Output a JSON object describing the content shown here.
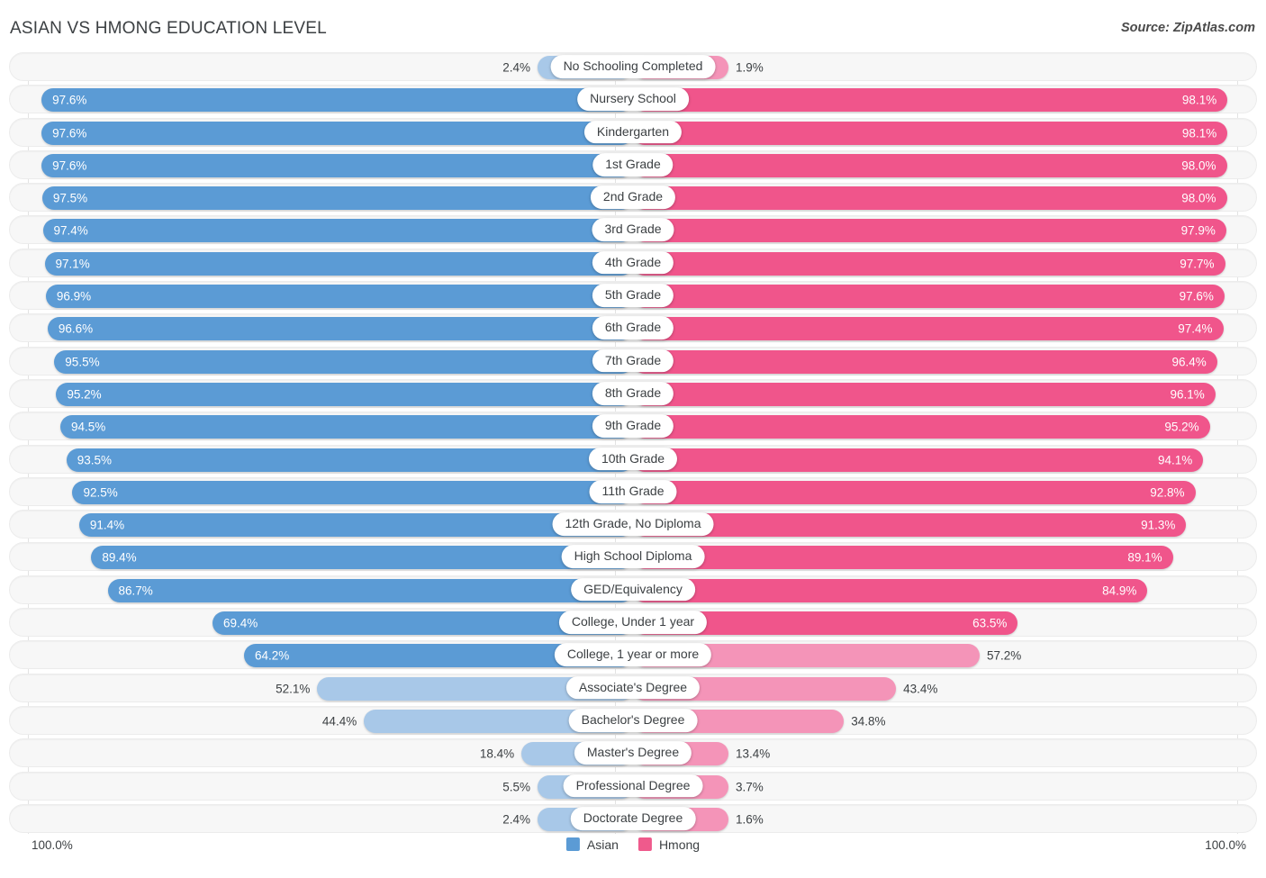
{
  "header": {
    "title": "ASIAN VS HMONG EDUCATION LEVEL",
    "source": "Source: ZipAtlas.com"
  },
  "axis": {
    "min_label": "100.0%",
    "max_label": "100.0%"
  },
  "legend": {
    "items": [
      {
        "label": "Asian",
        "color": "#5b9bd5"
      },
      {
        "label": "Hmong",
        "color": "#ef5a8c"
      }
    ]
  },
  "colors": {
    "asian_strong": "#5b9bd5",
    "asian_light": "#a8c8e8",
    "hmong_strong": "#f0558b",
    "hmong_light": "#f494b8",
    "track": "#f7f7f7",
    "gridline": "#e3e3e3"
  },
  "chart_data": {
    "type": "bar",
    "orientation": "horizontal-diverging",
    "title": "ASIAN VS HMONG EDUCATION LEVEL",
    "xlabel": "",
    "ylabel": "",
    "xlim": [
      0,
      100
    ],
    "grid": true,
    "legend_position": "bottom-center",
    "value_suffix": "%",
    "categories": [
      "No Schooling Completed",
      "Nursery School",
      "Kindergarten",
      "1st Grade",
      "2nd Grade",
      "3rd Grade",
      "4th Grade",
      "5th Grade",
      "6th Grade",
      "7th Grade",
      "8th Grade",
      "9th Grade",
      "10th Grade",
      "11th Grade",
      "12th Grade, No Diploma",
      "High School Diploma",
      "GED/Equivalency",
      "College, Under 1 year",
      "College, 1 year or more",
      "Associate's Degree",
      "Bachelor's Degree",
      "Master's Degree",
      "Professional Degree",
      "Doctorate Degree"
    ],
    "series": [
      {
        "name": "Asian",
        "color": "#5b9bd5",
        "values": [
          2.4,
          97.6,
          97.6,
          97.6,
          97.5,
          97.4,
          97.1,
          96.9,
          96.6,
          95.5,
          95.2,
          94.5,
          93.5,
          92.5,
          91.4,
          89.4,
          86.7,
          69.4,
          64.2,
          52.1,
          44.4,
          18.4,
          5.5,
          2.4
        ]
      },
      {
        "name": "Hmong",
        "color": "#f0558b",
        "values": [
          1.9,
          98.1,
          98.1,
          98.0,
          98.0,
          97.9,
          97.7,
          97.6,
          97.4,
          96.4,
          96.1,
          95.2,
          94.1,
          92.8,
          91.3,
          89.1,
          84.9,
          63.5,
          57.2,
          43.4,
          34.8,
          13.4,
          3.7,
          1.6
        ]
      }
    ]
  },
  "rows": [
    {
      "label": "No Schooling Completed",
      "left": "2.4%",
      "right": "1.9%"
    },
    {
      "label": "Nursery School",
      "left": "97.6%",
      "right": "98.1%"
    },
    {
      "label": "Kindergarten",
      "left": "97.6%",
      "right": "98.1%"
    },
    {
      "label": "1st Grade",
      "left": "97.6%",
      "right": "98.0%"
    },
    {
      "label": "2nd Grade",
      "left": "97.5%",
      "right": "98.0%"
    },
    {
      "label": "3rd Grade",
      "left": "97.4%",
      "right": "97.9%"
    },
    {
      "label": "4th Grade",
      "left": "97.1%",
      "right": "97.7%"
    },
    {
      "label": "5th Grade",
      "left": "96.9%",
      "right": "97.6%"
    },
    {
      "label": "6th Grade",
      "left": "96.6%",
      "right": "97.4%"
    },
    {
      "label": "7th Grade",
      "left": "95.5%",
      "right": "96.4%"
    },
    {
      "label": "8th Grade",
      "left": "95.2%",
      "right": "96.1%"
    },
    {
      "label": "9th Grade",
      "left": "94.5%",
      "right": "95.2%"
    },
    {
      "label": "10th Grade",
      "left": "93.5%",
      "right": "94.1%"
    },
    {
      "label": "11th Grade",
      "left": "92.5%",
      "right": "92.8%"
    },
    {
      "label": "12th Grade, No Diploma",
      "left": "91.4%",
      "right": "91.3%"
    },
    {
      "label": "High School Diploma",
      "left": "89.4%",
      "right": "89.1%"
    },
    {
      "label": "GED/Equivalency",
      "left": "86.7%",
      "right": "84.9%"
    },
    {
      "label": "College, Under 1 year",
      "left": "69.4%",
      "right": "63.5%"
    },
    {
      "label": "College, 1 year or more",
      "left": "64.2%",
      "right": "57.2%"
    },
    {
      "label": "Associate's Degree",
      "left": "52.1%",
      "right": "43.4%"
    },
    {
      "label": "Bachelor's Degree",
      "left": "44.4%",
      "right": "34.8%"
    },
    {
      "label": "Master's Degree",
      "left": "18.4%",
      "right": "13.4%"
    },
    {
      "label": "Professional Degree",
      "left": "5.5%",
      "right": "3.7%"
    },
    {
      "label": "Doctorate Degree",
      "left": "2.4%",
      "right": "1.6%"
    }
  ]
}
